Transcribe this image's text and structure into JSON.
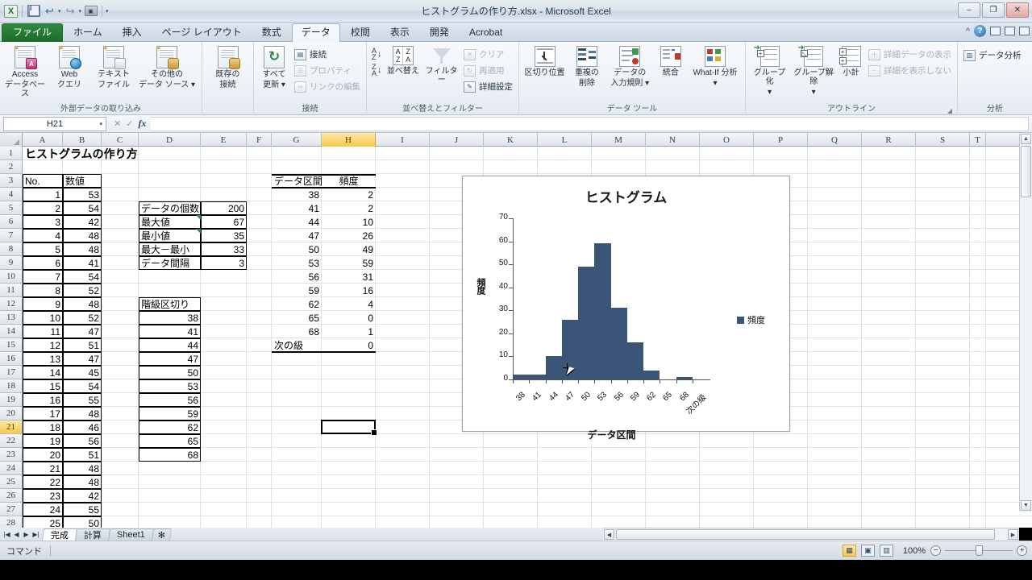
{
  "window": {
    "title": "ヒストグラムの作り方.xlsx  -  Microsoft Excel",
    "minimize": "–",
    "restore": "❐",
    "close": "✕"
  },
  "quick_access": {
    "logo": "X",
    "save": "save-icon",
    "undo": "↩",
    "redo": "↪",
    "camera": "📷",
    "dropdown": "▾"
  },
  "tabs": [
    {
      "label": "ファイル",
      "active": false,
      "file": true
    },
    {
      "label": "ホーム",
      "active": false
    },
    {
      "label": "挿入",
      "active": false
    },
    {
      "label": "ページ レイアウト",
      "active": false
    },
    {
      "label": "数式",
      "active": false
    },
    {
      "label": "データ",
      "active": true
    },
    {
      "label": "校閲",
      "active": false
    },
    {
      "label": "表示",
      "active": false
    },
    {
      "label": "開発",
      "active": false
    },
    {
      "label": "Acrobat",
      "active": false
    }
  ],
  "tabs_right": {
    "collapse": "^",
    "help": "?"
  },
  "ribbon": {
    "groups": [
      {
        "title": "外部データの取り込み",
        "buttons": [
          {
            "line1": "Access",
            "line2": "データベース"
          },
          {
            "line1": "Web",
            "line2": "クエリ"
          },
          {
            "line1": "テキスト",
            "line2": "ファイル"
          },
          {
            "line1": "その他の",
            "line2": "データ ソース ▾"
          }
        ]
      },
      {
        "title": "",
        "buttons": [
          {
            "line1": "既存の",
            "line2": "接続"
          }
        ]
      },
      {
        "title": "接続",
        "buttons": [
          {
            "line1": "すべて",
            "line2": "更新 ▾"
          }
        ],
        "small": [
          {
            "label": "接続",
            "dim": false
          },
          {
            "label": "プロパティ",
            "dim": true
          },
          {
            "label": "リンクの編集",
            "dim": true
          }
        ]
      },
      {
        "title": "並べ替えとフィルター",
        "sort_asc": "A→Z",
        "sort_desc": "Z→A",
        "buttons": [
          {
            "line1": "並べ替え",
            "line2": ""
          },
          {
            "line1": "フィルター",
            "line2": ""
          }
        ],
        "small": [
          {
            "label": "クリア",
            "dim": true
          },
          {
            "label": "再適用",
            "dim": true
          },
          {
            "label": "詳細設定",
            "dim": false
          }
        ]
      },
      {
        "title": "データ ツール",
        "buttons": [
          {
            "line1": "区切り位置",
            "line2": ""
          },
          {
            "line1": "重複の",
            "line2": "削除"
          },
          {
            "line1": "データの",
            "line2": "入力規則 ▾"
          },
          {
            "line1": "統合",
            "line2": ""
          },
          {
            "line1": "What-If 分析",
            "line2": "▾"
          }
        ]
      },
      {
        "title": "アウトライン",
        "dialog_launcher": "◢",
        "buttons": [
          {
            "line1": "グループ化",
            "line2": "▾"
          },
          {
            "line1": "グループ解除",
            "line2": "▾"
          },
          {
            "line1": "小計",
            "line2": ""
          }
        ],
        "small": [
          {
            "label": "詳細データの表示",
            "dim": true
          },
          {
            "label": "詳細を表示しない",
            "dim": true
          }
        ]
      },
      {
        "title": "分析",
        "small": [
          {
            "label": "データ分析",
            "dim": false
          }
        ]
      }
    ]
  },
  "formula_bar": {
    "name_box": "H21",
    "dropdown": "▾",
    "cancel": "✕",
    "enter": "✓",
    "fx": "fx",
    "value": ""
  },
  "grid": {
    "columns": [
      "A",
      "B",
      "C",
      "D",
      "E",
      "F",
      "G",
      "H",
      "I",
      "J",
      "K",
      "L",
      "M",
      "N",
      "O",
      "P",
      "Q",
      "R",
      "S",
      "T"
    ],
    "selected_column": "H",
    "rows": [
      1,
      2,
      3,
      4,
      5,
      6,
      7,
      8,
      9,
      10,
      11,
      12,
      13,
      14,
      15,
      16,
      17,
      18,
      19,
      20,
      21,
      22,
      23,
      24,
      25,
      26,
      27,
      28
    ],
    "selected_row": 21,
    "active_cell": "H21",
    "sheet_title": "ヒストグラムの作り方",
    "data_table": {
      "headers": [
        "No.",
        "数値"
      ],
      "rows": [
        [
          "1",
          "53"
        ],
        [
          "2",
          "54"
        ],
        [
          "3",
          "42"
        ],
        [
          "4",
          "48"
        ],
        [
          "5",
          "48"
        ],
        [
          "6",
          "41"
        ],
        [
          "7",
          "54"
        ],
        [
          "8",
          "52"
        ],
        [
          "9",
          "48"
        ],
        [
          "10",
          "52"
        ],
        [
          "11",
          "47"
        ],
        [
          "12",
          "51"
        ],
        [
          "13",
          "47"
        ],
        [
          "14",
          "45"
        ],
        [
          "15",
          "54"
        ],
        [
          "16",
          "55"
        ],
        [
          "17",
          "48"
        ],
        [
          "18",
          "46"
        ],
        [
          "19",
          "56"
        ],
        [
          "20",
          "51"
        ],
        [
          "21",
          "48"
        ],
        [
          "22",
          "48"
        ],
        [
          "23",
          "42"
        ],
        [
          "24",
          "55"
        ],
        [
          "25",
          "50"
        ]
      ]
    },
    "stats_table": {
      "rows": [
        {
          "label": "データの個数",
          "value": "200",
          "comment": false
        },
        {
          "label": "最大値",
          "value": "67",
          "comment": true
        },
        {
          "label": "最小値",
          "value": "35",
          "comment": true
        },
        {
          "label": "最大－最小",
          "value": "33",
          "comment": false
        },
        {
          "label": "データ間隔",
          "value": "3",
          "comment": false
        }
      ]
    },
    "bins_table": {
      "header": "階級区切り",
      "values": [
        "38",
        "41",
        "44",
        "47",
        "50",
        "53",
        "56",
        "59",
        "62",
        "65",
        "68"
      ]
    },
    "freq_table": {
      "headers": [
        "データ区間",
        "頻度"
      ],
      "rows": [
        [
          "38",
          "2"
        ],
        [
          "41",
          "2"
        ],
        [
          "44",
          "10"
        ],
        [
          "47",
          "26"
        ],
        [
          "50",
          "49"
        ],
        [
          "53",
          "59"
        ],
        [
          "56",
          "31"
        ],
        [
          "59",
          "16"
        ],
        [
          "62",
          "4"
        ],
        [
          "65",
          "0"
        ],
        [
          "68",
          "1"
        ],
        [
          "次の級",
          "0"
        ]
      ]
    }
  },
  "chart_data": {
    "type": "bar",
    "title": "ヒストグラム",
    "xlabel": "データ区間",
    "ylabel": "頻度",
    "categories": [
      "38",
      "41",
      "44",
      "47",
      "50",
      "53",
      "56",
      "59",
      "62",
      "65",
      "68",
      "次の級"
    ],
    "values": [
      2,
      2,
      10,
      26,
      49,
      59,
      31,
      16,
      4,
      0,
      1,
      0
    ],
    "ylim": [
      0,
      70
    ],
    "yticks": [
      0,
      10,
      20,
      30,
      40,
      50,
      60,
      70
    ],
    "grid": false,
    "legend": [
      "頻度"
    ],
    "legend_position": "right",
    "series_color": "#3a5578",
    "bar_gap": 0
  },
  "sheet_tabs": {
    "nav": [
      "|◀",
      "◀",
      "▶",
      "▶|"
    ],
    "items": [
      {
        "label": "完成",
        "active": true
      },
      {
        "label": "計算",
        "active": false
      },
      {
        "label": "Sheet1",
        "active": false
      },
      {
        "label": "✻",
        "active": false,
        "new": true
      }
    ]
  },
  "status_bar": {
    "mode": "コマンド",
    "views": [
      {
        "name": "normal-view",
        "glyph": "▦",
        "active": true
      },
      {
        "name": "page-layout-view",
        "glyph": "▣",
        "active": false
      },
      {
        "name": "page-break-view",
        "glyph": "▥",
        "active": false
      }
    ],
    "zoom": "100%",
    "zoom_out": "−",
    "zoom_in": "+"
  },
  "scrollbars": {
    "up": "▲",
    "down": "▼",
    "left": "◀",
    "right": "▶"
  }
}
